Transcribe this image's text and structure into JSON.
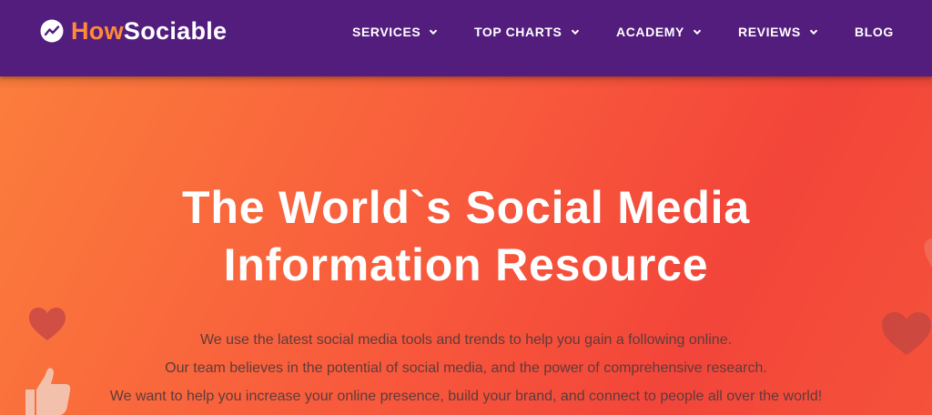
{
  "brand": {
    "name_part1": "How",
    "name_part2": "Sociable",
    "logo_icon": "trending-chart-icon"
  },
  "nav": {
    "items": [
      {
        "label": "SERVICES",
        "has_dropdown": true
      },
      {
        "label": "TOP CHARTS",
        "has_dropdown": true
      },
      {
        "label": "ACADEMY",
        "has_dropdown": true
      },
      {
        "label": "REVIEWS",
        "has_dropdown": true
      },
      {
        "label": "BLOG",
        "has_dropdown": false
      }
    ]
  },
  "hero": {
    "title_line1": "The World`s Social Media",
    "title_line2": "Information Resource",
    "paragraphs": [
      "We use the latest social media tools and trends to help you gain a following online.",
      "Our team believes in the potential of social media, and the power of comprehensive research.",
      "We want to help you increase your online presence, build your brand, and connect to people all over the world!"
    ],
    "decorations": [
      "heart-icon",
      "thumbs-up-icon",
      "heart-icon"
    ]
  },
  "colors": {
    "header_bg": "#531d7e",
    "brand_accent": "#ff8a38",
    "hero_gradient_start": "#fb7d3c",
    "hero_gradient_end": "#f3453a",
    "hero_text": "#ffffff",
    "body_text": "#5e3b3a"
  }
}
